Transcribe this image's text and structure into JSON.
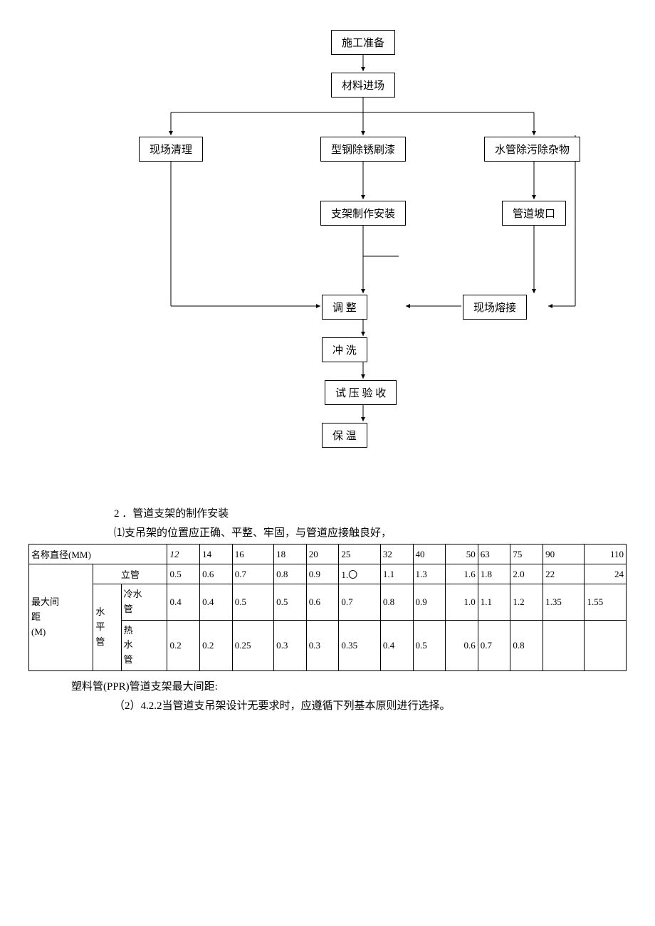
{
  "flow": {
    "n1": "施工准备",
    "n2": "材料进场",
    "n3": "现场清理",
    "n4": "型钢除锈刷漆",
    "n5": "水管除污除杂物",
    "n6": "支架制作安装",
    "n7": "管道坡口",
    "n8": "调    整",
    "n9": "现场熔接",
    "n10": "冲    洗",
    "n11": "试 压 验 收",
    "n12": "保    温"
  },
  "sec2_title": "2 ．管道支架的制作安装",
  "sec2_p1": "⑴支吊架的位置应正确、平整、牢固，与管道应接触良好，",
  "table": {
    "h_name": "名称直径(MM)",
    "diameters": [
      "12",
      "14",
      "16",
      "18",
      "20",
      "25",
      "32",
      "40",
      "50",
      "63",
      "75",
      "90",
      "110"
    ],
    "maxspan_label_l1": "最大间",
    "maxspan_label_l2": "距",
    "maxspan_label_l3": "(M)",
    "lg_label": "立管",
    "lg_vals": [
      "0.5",
      "0.6",
      "0.7",
      "0.8",
      "0.9",
      "1.〇",
      "1.1",
      "1.3",
      "1.6",
      "1.8",
      "2.0",
      "22",
      "24"
    ],
    "hp_label_l1": "水",
    "hp_label_l2": "平",
    "hp_label_l3": "管",
    "cold_l1": "冷水",
    "cold_l2": "管",
    "cold_vals": [
      "0.4",
      "0.4",
      "0.5",
      "0.5",
      "0.6",
      "0.7",
      "0.8",
      "0.9",
      "1.0",
      "1.1",
      "1.2",
      "1.35",
      "1.55"
    ],
    "hot_l1": "热",
    "hot_l2": "水",
    "hot_l3": "管",
    "hot_vals": [
      "0.2",
      "0.2",
      "0.25",
      "0.3",
      "0.3",
      "0.35",
      "0.4",
      "0.5",
      "0.6",
      "0.7",
      "0.8",
      "",
      ""
    ]
  },
  "caption": "塑料管(PPR)管道支架最大间距:",
  "sec2_p2": "（2）4.2.2当管道支吊架设计无要求时，应遵循下列基本原则进行选择。"
}
